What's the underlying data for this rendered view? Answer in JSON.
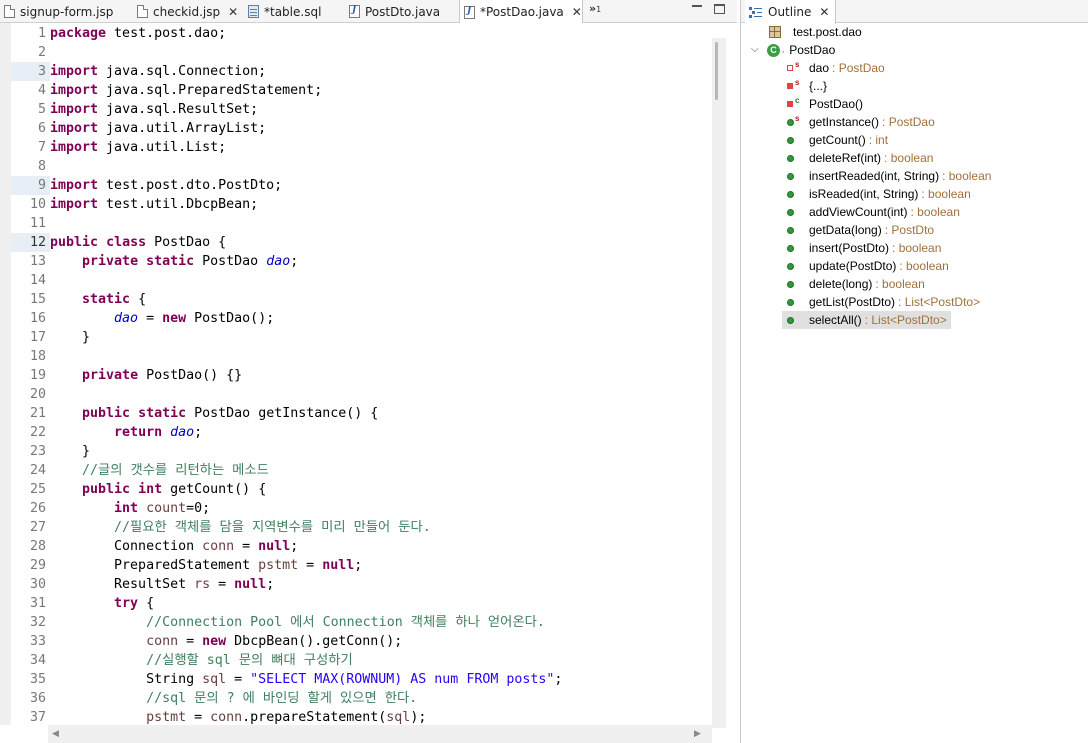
{
  "editor_tabs": [
    {
      "label": "signup-form.jsp",
      "icon": "jsp-file-icon"
    },
    {
      "label": "checkid.jsp",
      "icon": "jsp-file-icon"
    },
    {
      "label": "*table.sql",
      "icon": "sql-file-icon"
    },
    {
      "label": "PostDto.java",
      "icon": "java-file-icon"
    },
    {
      "label": "*PostDao.java",
      "icon": "java-file-icon",
      "active": true
    }
  ],
  "tab_overflow": {
    "symbol": "»",
    "count": "1"
  },
  "line_numbers": [
    "1",
    "2",
    "3",
    "4",
    "5",
    "6",
    "7",
    "8",
    "9",
    "10",
    "11",
    "12",
    "13",
    "14",
    "15",
    "16",
    "17",
    "18",
    "19",
    "20",
    "21",
    "22",
    "23",
    "24",
    "25",
    "26",
    "27",
    "28",
    "29",
    "30",
    "31",
    "32",
    "33",
    "34",
    "35",
    "36",
    "37"
  ],
  "code_lines": [
    "package test.post.dao;",
    "",
    "import java.sql.Connection;",
    "import java.sql.PreparedStatement;",
    "import java.sql.ResultSet;",
    "import java.util.ArrayList;",
    "import java.util.List;",
    "",
    "import test.post.dto.PostDto;",
    "import test.util.DbcpBean;",
    "",
    "public class PostDao {",
    "    private static PostDao dao;",
    "",
    "    static {",
    "        dao = new PostDao();",
    "    }",
    "",
    "    private PostDao() {}",
    "",
    "    public static PostDao getInstance() {",
    "        return dao;",
    "    }",
    "    //글의 갯수를 리턴하는 메소드",
    "    public int getCount() {",
    "        int count=0;",
    "        //필요한 객체를 담을 지역변수를 미리 만들어 둔다.",
    "        Connection conn = null;",
    "        PreparedStatement pstmt = null;",
    "        ResultSet rs = null;",
    "        try {",
    "            //Connection Pool 에서 Connection 객체를 하나 얻어온다.",
    "            conn = new DbcpBean().getConn();",
    "            //실행할 sql 문의 뼈대 구성하기",
    "            String sql = \"SELECT MAX(ROWNUM) AS num FROM posts\";",
    "            //sql 문의 ? 에 바인딩 할게 있으면 한다.",
    "            pstmt = conn.prepareStatement(sql);"
  ],
  "outline": {
    "tab_label": "Outline",
    "package": "test.post.dao",
    "class_name": "PostDao",
    "members": [
      {
        "name": "dao",
        "type": ": PostDao",
        "kind": "private-static-field"
      },
      {
        "name": "{...}",
        "type": "",
        "kind": "static-block"
      },
      {
        "name": "PostDao()",
        "type": "",
        "kind": "private-constructor"
      },
      {
        "name": "getInstance()",
        "type": ": PostDao",
        "kind": "public-static-method"
      },
      {
        "name": "getCount()",
        "type": ": int",
        "kind": "public-method"
      },
      {
        "name": "deleteRef(int)",
        "type": ": boolean",
        "kind": "public-method"
      },
      {
        "name": "insertReaded(int, String)",
        "type": ": boolean",
        "kind": "public-method"
      },
      {
        "name": "isReaded(int, String)",
        "type": ": boolean",
        "kind": "public-method"
      },
      {
        "name": "addViewCount(int)",
        "type": ": boolean",
        "kind": "public-method"
      },
      {
        "name": "getData(long)",
        "type": ": PostDto",
        "kind": "public-method"
      },
      {
        "name": "insert(PostDto)",
        "type": ": boolean",
        "kind": "public-method"
      },
      {
        "name": "update(PostDto)",
        "type": ": boolean",
        "kind": "public-method"
      },
      {
        "name": "delete(long)",
        "type": ": boolean",
        "kind": "public-method"
      },
      {
        "name": "getList(PostDto)",
        "type": ": List<PostDto>",
        "kind": "public-method"
      },
      {
        "name": "selectAll()",
        "type": ": List<PostDto>",
        "kind": "public-method",
        "selected": true
      }
    ]
  },
  "colors": {
    "keyword": "#7f0055",
    "field": "#0000c0",
    "string": "#2a00ff",
    "comment": "#3f7f5f",
    "local_var": "#6a3e3e",
    "type_hint": "#a0703c"
  }
}
